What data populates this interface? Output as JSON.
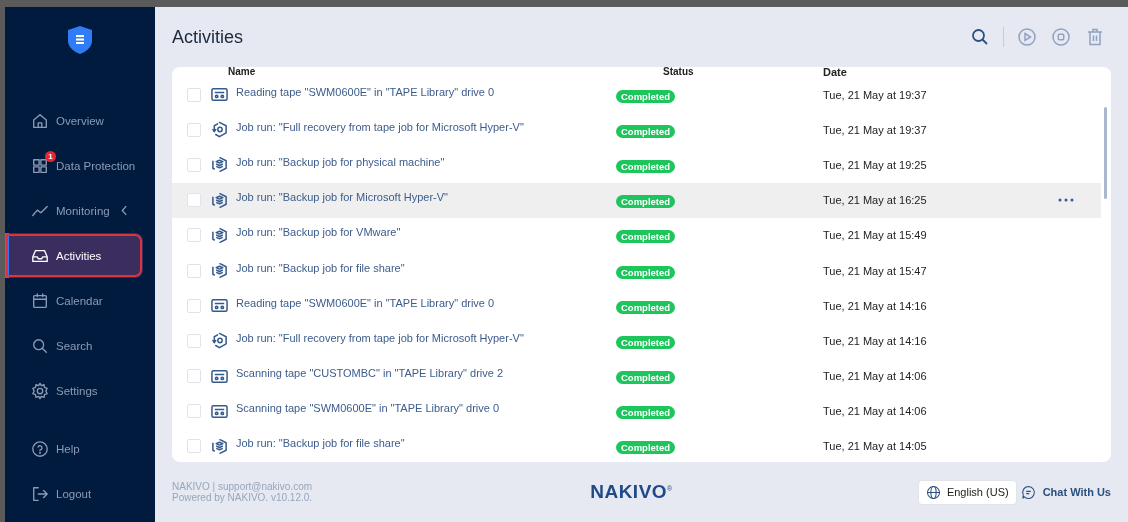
{
  "sidebar": {
    "items": [
      {
        "kind": "home",
        "label": "Overview",
        "selected": false
      },
      {
        "kind": "grid",
        "label": "Data Protection",
        "selected": false,
        "badge": "1"
      },
      {
        "kind": "chart",
        "label": "Monitoring",
        "selected": false,
        "collapsible": true
      },
      {
        "kind": "inbox",
        "label": "Activities",
        "selected": true
      },
      {
        "kind": "calendar",
        "label": "Calendar",
        "selected": false
      },
      {
        "kind": "search",
        "label": "Search",
        "selected": false
      },
      {
        "kind": "gear",
        "label": "Settings",
        "selected": false
      }
    ],
    "bottom_items": [
      {
        "kind": "help",
        "label": "Help"
      },
      {
        "kind": "logout",
        "label": "Logout"
      }
    ]
  },
  "page": {
    "title": "Activities"
  },
  "table": {
    "columns": [
      "Name",
      "Status",
      "Date"
    ],
    "rows": [
      {
        "kind": "tape",
        "name": "Reading tape \"SWM0600E\" in \"TAPE Library\" drive 0",
        "status": "Completed",
        "date": "Tue, 21 May at 19:37",
        "highlighted": false,
        "checked": false
      },
      {
        "kind": "recovery",
        "name": "Job run: \"Full recovery from tape job for Microsoft Hyper-V\"",
        "status": "Completed",
        "date": "Tue, 21 May at 19:37",
        "highlighted": false,
        "checked": false
      },
      {
        "kind": "backup",
        "name": "Job run: \"Backup job for physical machine\"",
        "status": "Completed",
        "date": "Tue, 21 May at 19:25",
        "highlighted": false,
        "checked": false
      },
      {
        "kind": "backup",
        "name": "Job run: \"Backup job for Microsoft Hyper-V\"",
        "status": "Completed",
        "date": "Tue, 21 May at 16:25",
        "highlighted": true,
        "checked": false
      },
      {
        "kind": "backup",
        "name": "Job run: \"Backup job for VMware\"",
        "status": "Completed",
        "date": "Tue, 21 May at 15:49",
        "highlighted": false,
        "checked": false
      },
      {
        "kind": "backup",
        "name": "Job run: \"Backup job for file share\"",
        "status": "Completed",
        "date": "Tue, 21 May at 15:47",
        "highlighted": false,
        "checked": false
      },
      {
        "kind": "tape",
        "name": "Reading tape \"SWM0600E\" in \"TAPE Library\" drive 0",
        "status": "Completed",
        "date": "Tue, 21 May at 14:16",
        "highlighted": false,
        "checked": false
      },
      {
        "kind": "recovery",
        "name": "Job run: \"Full recovery from tape job for Microsoft Hyper-V\"",
        "status": "Completed",
        "date": "Tue, 21 May at 14:16",
        "highlighted": false,
        "checked": false
      },
      {
        "kind": "tape",
        "name": "Scanning tape \"CUSTOMBC\" in \"TAPE Library\" drive 2",
        "status": "Completed",
        "date": "Tue, 21 May at 14:06",
        "highlighted": false,
        "checked": false
      },
      {
        "kind": "tape",
        "name": "Scanning tape \"SWM0600E\" in \"TAPE Library\" drive 0",
        "status": "Completed",
        "date": "Tue, 21 May at 14:06",
        "highlighted": false,
        "checked": false
      },
      {
        "kind": "backup",
        "name": "Job run: \"Backup job for file share\"",
        "status": "Completed",
        "date": "Tue, 21 May at 14:05",
        "highlighted": false,
        "checked": false
      }
    ]
  },
  "footer": {
    "contact": "NAKIVO | support@nakivo.com",
    "version": "Powered by NAKIVO. v10.12.0.",
    "logo": "NAKIVO",
    "logo_mark": "®",
    "language": "English (US)",
    "chat": "Chat With Us"
  }
}
